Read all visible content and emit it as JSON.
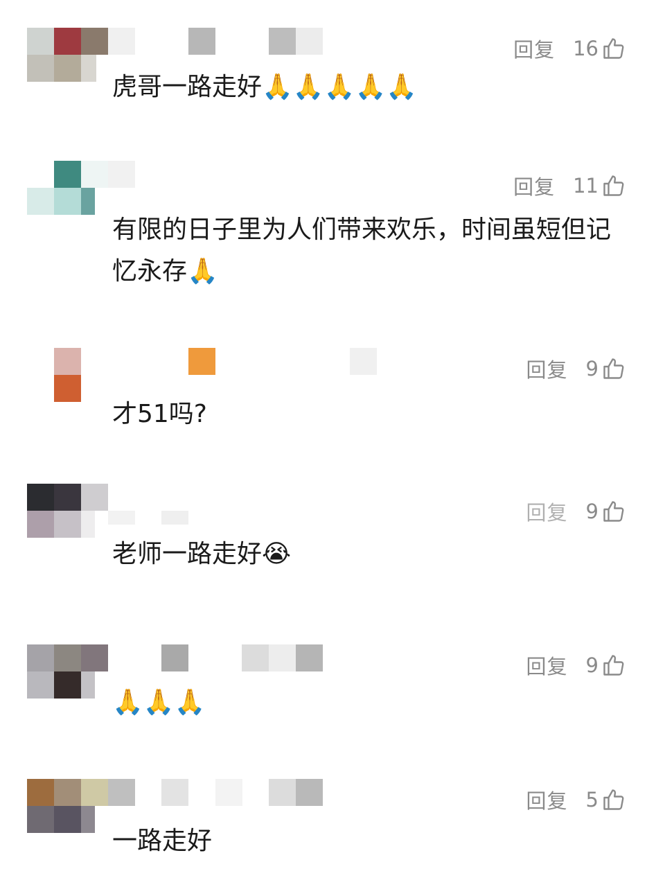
{
  "comments": [
    {
      "text": "虎哥一路走好🙏🙏🙏🙏🙏",
      "reply_label": "回复",
      "likes": "16",
      "avatar_colors": [
        "#cfd3d0",
        "#9e3a40",
        "#8a7a6c",
        "#c2c0b8",
        "#b3ab9a",
        "#d8d6d0"
      ]
    },
    {
      "text": "有限的日子里为人们带来欢乐，时间虽短但记忆永存🙏",
      "reply_label": "回复",
      "likes": "11",
      "avatar_colors": [
        "#ffffff",
        "#3f8a80",
        "#eef5f4",
        "#d8ebe8",
        "#b4dcd7",
        "#6aa3a0"
      ]
    },
    {
      "text": "才51吗?",
      "reply_label": "回复",
      "likes": "9",
      "avatar_colors": [
        "#ffffff",
        "#dbb3ad",
        "#ffffff",
        "#fbf9f8",
        "#cf5f31",
        "#fafafa"
      ]
    },
    {
      "text": "老师一路走好😭",
      "reply_label": "回复",
      "likes": "9",
      "avatar_colors": [
        "#2b2c30",
        "#3a363e",
        "#cfcdd0",
        "#ad9faa",
        "#c6c1c7",
        "#eeedee"
      ]
    },
    {
      "text": "🙏🙏🙏",
      "reply_label": "回复",
      "likes": "9",
      "avatar_colors": [
        "#a5a3a8",
        "#8c8781",
        "#81767c",
        "#b9b8bd",
        "#352b2a",
        "#c4c2c6"
      ]
    },
    {
      "text": "一路走好",
      "reply_label": "回复",
      "likes": "5",
      "avatar_colors": [
        "#9d6c3e",
        "#a28e78",
        "#cfc9a5",
        "#6f6a72",
        "#595461",
        "#8d8890"
      ]
    }
  ]
}
